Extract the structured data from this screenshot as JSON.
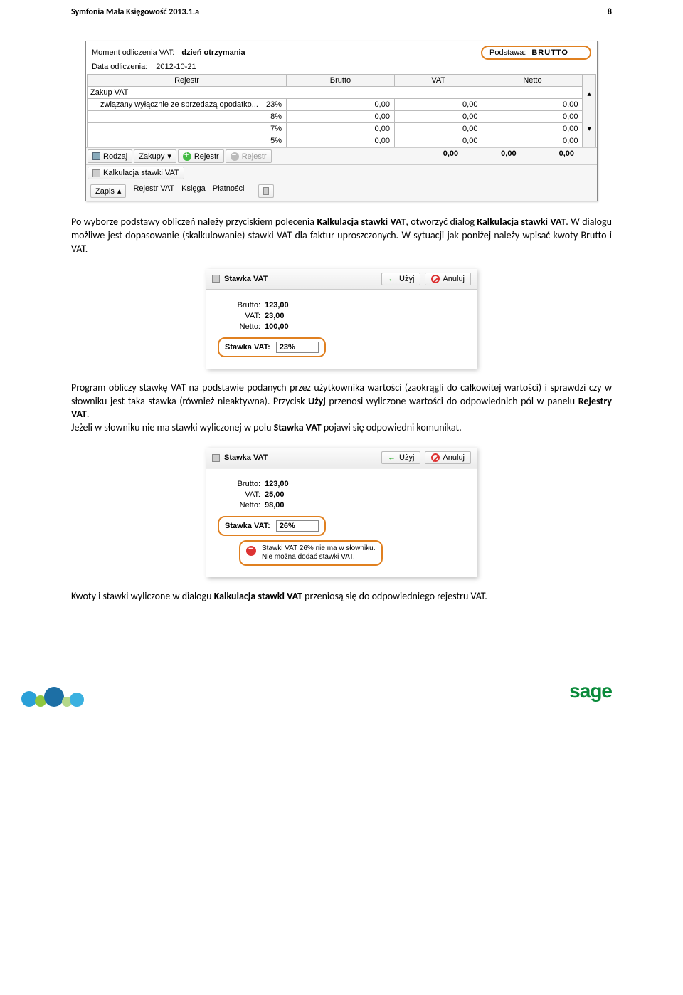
{
  "header": {
    "title": "Symfonia Mała Księgowość 2013.1.a",
    "page": "8"
  },
  "panel": {
    "moment_label": "Moment odliczenia VAT:",
    "moment_value": "dzień otrzymania",
    "data_label": "Data odliczenia:",
    "data_value": "2012-10-21",
    "podstawa_label": "Podstawa:",
    "podstawa_value": "BRUTTO",
    "cols": {
      "rejestr": "Rejestr",
      "brutto": "Brutto",
      "vat": "VAT",
      "netto": "Netto"
    },
    "group_label": "Zakup VAT",
    "group_sub": "związany wyłącznie ze sprzedażą opodatko...",
    "rows": [
      {
        "rate": "23%",
        "brutto": "0,00",
        "vat": "0,00",
        "netto": "0,00"
      },
      {
        "rate": "8%",
        "brutto": "0,00",
        "vat": "0,00",
        "netto": "0,00"
      },
      {
        "rate": "7%",
        "brutto": "0,00",
        "vat": "0,00",
        "netto": "0,00"
      },
      {
        "rate": "5%",
        "brutto": "0,00",
        "vat": "0,00",
        "netto": "0,00"
      }
    ],
    "totals": {
      "brutto": "0,00",
      "vat": "0,00",
      "netto": "0,00"
    },
    "btns": {
      "rodzaj": "Rodzaj",
      "zakupy": "Zakupy",
      "rejestr_add": "Rejestr",
      "rejestr_del": "Rejestr",
      "kalk": "Kalkulacja stawki VAT"
    },
    "tabs": {
      "zapis": "Zapis",
      "rej": "Rejestr VAT",
      "ksiega": "Księga",
      "plat": "Płatności"
    }
  },
  "para1_a": "Po wyborze podstawy obliczeń należy przyciskiem polecenia ",
  "para1_b": "Kalkulacja stawki VAT",
  "para1_c": ", otworzyć dialog ",
  "para1_d": "Kalkulacja stawki VAT",
  "para1_e": ". W dialogu możliwe jest dopasowanie (skalkulowanie) stawki VAT dla faktur uproszczonych. W sytuacji jak poniżej należy wpisać kwoty Brutto i VAT.",
  "dlg1": {
    "title": "Stawka VAT",
    "use": "Użyj",
    "cancel": "Anuluj",
    "brutto_l": "Brutto:",
    "brutto_v": "123,00",
    "vat_l": "VAT:",
    "vat_v": "23,00",
    "netto_l": "Netto:",
    "netto_v": "100,00",
    "rate_l": "Stawka VAT:",
    "rate_v": "23%"
  },
  "para2_a": "Program obliczy stawkę VAT na podstawie podanych przez użytkownika wartości (zaokrągli do całkowitej wartości) i sprawdzi czy w słowniku jest taka stawka (również nieaktywna). Przycisk ",
  "para2_b": "Użyj",
  "para2_c": " przenosi wyliczone wartości do odpowiednich pól w panelu ",
  "para2_d": "Rejestry VAT",
  "para2_e": ".",
  "para2_f": "Jeżeli w słowniku nie ma stawki wyliczonej w polu ",
  "para2_g": "Stawka VAT",
  "para2_h": " pojawi się odpowiedni komunikat.",
  "dlg2": {
    "title": "Stawka VAT",
    "use": "Użyj",
    "cancel": "Anuluj",
    "brutto_l": "Brutto:",
    "brutto_v": "123,00",
    "vat_l": "VAT:",
    "vat_v": "25,00",
    "netto_l": "Netto:",
    "netto_v": "98,00",
    "rate_l": "Stawka VAT:",
    "rate_v": "26%",
    "warn1": "Stawki VAT 26% nie ma w słowniku.",
    "warn2": "Nie można dodać stawki VAT."
  },
  "para3_a": "Kwoty i stawki wyliczone w dialogu ",
  "para3_b": "Kalkulacja stawki VAT",
  "para3_c": " przeniosą się do odpowiedniego rejestru VAT.",
  "footer": {
    "logo": "sage"
  }
}
